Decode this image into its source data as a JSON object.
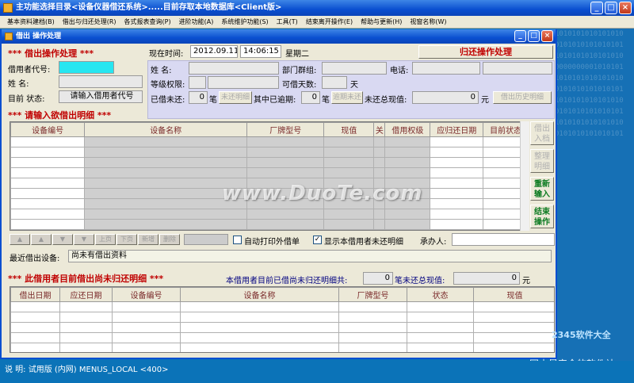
{
  "window_title": "主功能选择目录<设备仪器借还系统>.....目前存取本地数据库<Client版>",
  "menu": [
    "基本资料建档(B)",
    "借出与归还处理(R)",
    "各式报表查询(P)",
    "进阶功能(A)",
    "系统维护功能(S)",
    "工具(T)",
    "结束离开操作(E)",
    "帮助与更新(H)",
    "视窗名称(W)"
  ],
  "desktop_pattern": "1010101010101010\n0101010101010101\n1010101010101010\n0000000001010101\n1010101010101010\n0101010101010101\n1010101010101010\n0101010101010101\n1010101010101010\n0101010101010101",
  "inner_title": "借出  操作处理",
  "top": {
    "heading": "***  借出操作处理  ***",
    "now_label": "现在时间:",
    "date": "2012.09.11",
    "time": "14:06:15",
    "weekday": "星期二",
    "return_button": "归还操作处理"
  },
  "borrower": {
    "code_label": "借用者代号:",
    "name_label": "姓        名:",
    "status_label": "目前  状态:",
    "status_value": "请输入借用者代号"
  },
  "info": {
    "name_label": "姓      名:",
    "dept_label": "部门群组:",
    "phone_label": "电话:",
    "level_label": "等级权限:",
    "days_label": "可借天数:",
    "days_unit": "天",
    "unreturned_label": "已借未还:",
    "unreturned_value": "0",
    "unit_bi": "笔",
    "unreturned_btn": "未还明细",
    "overdue_label": "其中已逾期:",
    "overdue_value": "0",
    "overdue_btn": "逾期未还",
    "total_label": "未还总现值:",
    "total_value": "0",
    "unit_yuan": "元",
    "history_btn": "借出历史明细"
  },
  "detail": {
    "heading": "***  请输入欲借出明细  ***",
    "columns": [
      "设备编号",
      "设备名称",
      "厂牌型号",
      "现值",
      "关",
      "借用权级",
      "应归还日期",
      "目前状态"
    ]
  },
  "side_buttons": [
    {
      "label": "借出入档",
      "state": "disabled"
    },
    {
      "label": "整理明细",
      "state": "disabled"
    },
    {
      "label": "重新输入",
      "state": "active"
    },
    {
      "label": "结束操作",
      "state": "active"
    }
  ],
  "nav": {
    "buttons": [
      "▲",
      "▲",
      "▼",
      "▼",
      "上页",
      "下页",
      "新增",
      "删除"
    ],
    "auto_print_label": "自动打印外借单",
    "show_unreturned_label": "显示本借用者未还明细",
    "handler_label": "承办人:"
  },
  "recent": {
    "label": "最近借出设备:",
    "value": "尚未有借出资料"
  },
  "unreturned": {
    "heading": "***  此借用者目前借出尚未归还明细  ***",
    "count_label": "本借用者目前已借尚未归还明细共:",
    "count_value": "0",
    "total_label": "笔未还总现值:",
    "total_value": "0",
    "unit_yuan": "元",
    "columns": [
      "借出日期",
      "应还日期",
      "设备编号",
      "设备名称",
      "厂牌型号",
      "状态",
      "现值"
    ]
  },
  "statusbar": {
    "text": "说      明: 试用版 (内网) MENUS_LOCAL <400>"
  },
  "watermark": "www.DuoTe.com",
  "logo_watermark": "2345软件大全",
  "logo_slogan": "国内最安全的软件站"
}
